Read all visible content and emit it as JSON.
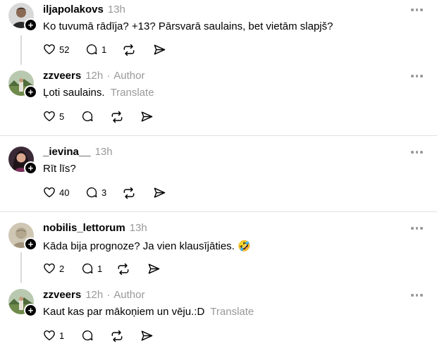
{
  "posts": [
    {
      "username": "iljapolakovs",
      "time": "13h",
      "author_tag": "",
      "text": "Ko tuvumā rādīja? +13? Pārsvarā saulains, bet vietām slapjš?",
      "translate": "",
      "likes": "52",
      "replies": "1"
    },
    {
      "username": "zzveers",
      "time": "12h",
      "author_tag": "Author",
      "text": "Ļoti saulains.",
      "translate": "Translate",
      "likes": "5",
      "replies": ""
    },
    {
      "username": "_ievina__",
      "time": "13h",
      "author_tag": "",
      "text": "Rīt līs?",
      "translate": "",
      "likes": "40",
      "replies": "3"
    },
    {
      "username": "nobilis_lettorum",
      "time": "13h",
      "author_tag": "",
      "text": "Kāda bija prognoze? Ja vien klausījāties. 🤣",
      "translate": "",
      "likes": "2",
      "replies": "1"
    },
    {
      "username": "zzveers",
      "time": "12h",
      "author_tag": "Author",
      "text": "Kaut kas par mākoņiem un vēju.:D",
      "translate": "Translate",
      "likes": "1",
      "replies": ""
    }
  ],
  "icons": {
    "like": "heart-icon",
    "reply": "comment-icon",
    "repost": "repost-icon",
    "share": "send-icon",
    "more": "more-icon",
    "follow": "plus-icon"
  },
  "colors": {
    "muted": "#999999",
    "divider": "#e0e0e0",
    "thread_line": "#d9d9d9"
  }
}
